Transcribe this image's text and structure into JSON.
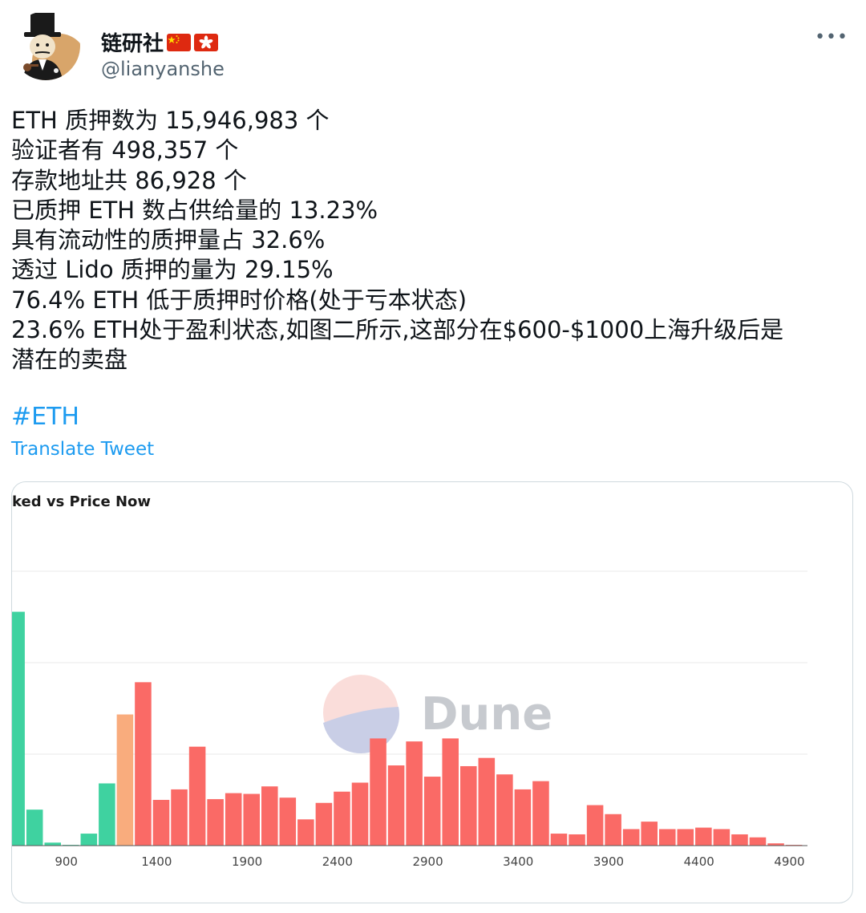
{
  "user": {
    "display_name": "链研社",
    "handle": "@lianyanshe",
    "more_label": "•••"
  },
  "tweet": {
    "lines": [
      "ETH 质押数为 15,946,983 个",
      "验证者有 498,357 个",
      "存款地址共 86,928 个",
      "已质押 ETH 数占供给量的 13.23%",
      "具有流动性的质押量占 32.6%",
      "透过 Lido 质押的量为 29.15%",
      "76.4% ETH 低于质押时价格(处于亏本状态)",
      "23.6% ETH处于盈利状态,如图二所示,这部分在$600-$1000上海升级后是",
      "潜在的卖盘"
    ],
    "hashtag": "#ETH",
    "translate_label": "Translate Tweet"
  },
  "colors": {
    "accent": "#1d9bf0",
    "green": "#3fd2a0",
    "orange": "#f9ac7d",
    "red": "#fa6a66"
  },
  "chart_data": {
    "type": "bar",
    "title": "ked vs Price Now",
    "watermark": "Dune",
    "x_ticks": [
      "900",
      "1400",
      "1900",
      "2400",
      "2900",
      "3400",
      "3900",
      "4400",
      "4900"
    ],
    "xlim": [
      600,
      5000
    ],
    "ylim": [
      0,
      380
    ],
    "bars": [
      {
        "x": 625,
        "value": 312,
        "color": "green"
      },
      {
        "x": 725,
        "value": 48,
        "color": "green"
      },
      {
        "x": 825,
        "value": 4,
        "color": "green"
      },
      {
        "x": 925,
        "value": 1,
        "color": "green"
      },
      {
        "x": 1025,
        "value": 16,
        "color": "green"
      },
      {
        "x": 1125,
        "value": 83,
        "color": "green"
      },
      {
        "x": 1225,
        "value": 175,
        "color": "orange"
      },
      {
        "x": 1325,
        "value": 218,
        "color": "red"
      },
      {
        "x": 1425,
        "value": 61,
        "color": "red"
      },
      {
        "x": 1525,
        "value": 75,
        "color": "red"
      },
      {
        "x": 1625,
        "value": 132,
        "color": "red"
      },
      {
        "x": 1725,
        "value": 62,
        "color": "red"
      },
      {
        "x": 1825,
        "value": 70,
        "color": "red"
      },
      {
        "x": 1925,
        "value": 69,
        "color": "red"
      },
      {
        "x": 2025,
        "value": 79,
        "color": "red"
      },
      {
        "x": 2125,
        "value": 64,
        "color": "red"
      },
      {
        "x": 2225,
        "value": 35,
        "color": "red"
      },
      {
        "x": 2325,
        "value": 57,
        "color": "red"
      },
      {
        "x": 2425,
        "value": 72,
        "color": "red"
      },
      {
        "x": 2525,
        "value": 84,
        "color": "red"
      },
      {
        "x": 2625,
        "value": 143,
        "color": "red"
      },
      {
        "x": 2725,
        "value": 107,
        "color": "red"
      },
      {
        "x": 2825,
        "value": 139,
        "color": "red"
      },
      {
        "x": 2925,
        "value": 92,
        "color": "red"
      },
      {
        "x": 3025,
        "value": 143,
        "color": "red"
      },
      {
        "x": 3125,
        "value": 106,
        "color": "red"
      },
      {
        "x": 3225,
        "value": 117,
        "color": "red"
      },
      {
        "x": 3325,
        "value": 95,
        "color": "red"
      },
      {
        "x": 3425,
        "value": 75,
        "color": "red"
      },
      {
        "x": 3525,
        "value": 86,
        "color": "red"
      },
      {
        "x": 3625,
        "value": 16,
        "color": "red"
      },
      {
        "x": 3725,
        "value": 15,
        "color": "red"
      },
      {
        "x": 3825,
        "value": 54,
        "color": "red"
      },
      {
        "x": 3925,
        "value": 42,
        "color": "red"
      },
      {
        "x": 4025,
        "value": 22,
        "color": "red"
      },
      {
        "x": 4125,
        "value": 32,
        "color": "red"
      },
      {
        "x": 4225,
        "value": 22,
        "color": "red"
      },
      {
        "x": 4325,
        "value": 22,
        "color": "red"
      },
      {
        "x": 4425,
        "value": 24,
        "color": "red"
      },
      {
        "x": 4525,
        "value": 22,
        "color": "red"
      },
      {
        "x": 4625,
        "value": 15,
        "color": "red"
      },
      {
        "x": 4725,
        "value": 11,
        "color": "red"
      },
      {
        "x": 4825,
        "value": 3,
        "color": "red"
      },
      {
        "x": 4925,
        "value": 1,
        "color": "red"
      }
    ],
    "grid": true,
    "legend": "none"
  }
}
